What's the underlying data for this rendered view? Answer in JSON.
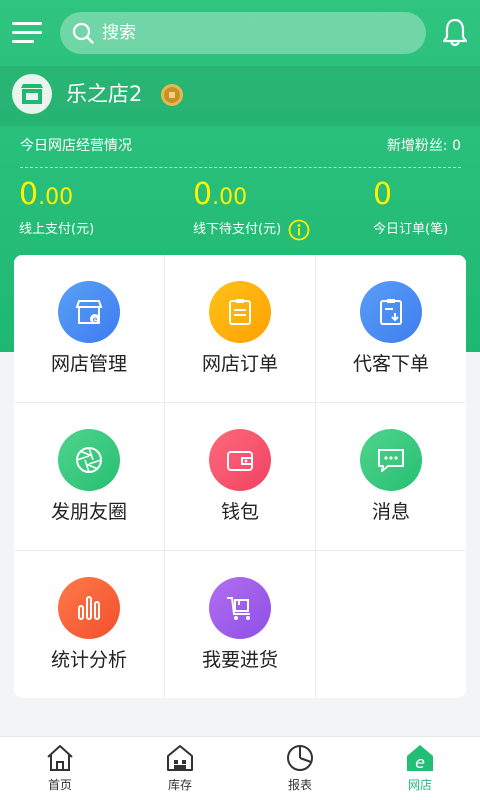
{
  "search": {
    "placeholder": "搜索"
  },
  "store": {
    "name": "乐之店2"
  },
  "summary": {
    "title": "今日网店经营情况",
    "fans_label": "新增粉丝: 0",
    "stats": [
      {
        "int": "0",
        "dec": ".00",
        "label": "线上支付(元)"
      },
      {
        "int": "0",
        "dec": ".00",
        "label": "线下待支付(元)"
      },
      {
        "int": "0",
        "dec": "",
        "label": "今日订单(笔)"
      }
    ]
  },
  "grid": {
    "items": [
      {
        "label": "网店管理",
        "icon": "store-manage-icon",
        "color_from": "#5aa0f6",
        "color_to": "#3d7cf0"
      },
      {
        "label": "网店订单",
        "icon": "order-clipboard-icon",
        "color_from": "#ffc21a",
        "color_to": "#ffa000"
      },
      {
        "label": "代客下单",
        "icon": "proxy-order-icon",
        "color_from": "#5a9cf7",
        "color_to": "#3e7ef0"
      },
      {
        "label": "发朋友圈",
        "icon": "moments-shutter-icon",
        "color_from": "#4fd48c",
        "color_to": "#27bf73"
      },
      {
        "label": "钱包",
        "icon": "wallet-icon",
        "color_from": "#ff6a7c",
        "color_to": "#ef4262"
      },
      {
        "label": "消息",
        "icon": "message-icon",
        "color_from": "#4fd48c",
        "color_to": "#27bf73"
      },
      {
        "label": "统计分析",
        "icon": "stats-bars-icon",
        "color_from": "#ff7a4a",
        "color_to": "#f24f2c"
      },
      {
        "label": "我要进货",
        "icon": "purchase-cart-icon",
        "color_from": "#b16ff0",
        "color_to": "#8e4fe6"
      }
    ]
  },
  "tabbar": {
    "items": [
      {
        "label": "首页",
        "icon": "home-icon"
      },
      {
        "label": "库存",
        "icon": "inventory-icon"
      },
      {
        "label": "报表",
        "icon": "report-icon"
      },
      {
        "label": "网店",
        "icon": "online-store-icon",
        "active": true
      }
    ]
  },
  "colors": {
    "primary": "#22bd77",
    "highlight": "#fff200"
  }
}
